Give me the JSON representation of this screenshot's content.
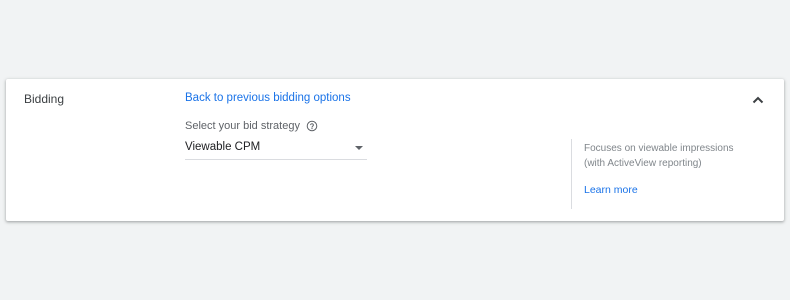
{
  "bidding": {
    "title": "Bidding",
    "back_link": "Back to previous bidding options",
    "strategy_label": "Select your bid strategy",
    "strategy_value": "Viewable CPM",
    "description": "Focuses on viewable impressions (with ActiveView reporting)",
    "learn_more": "Learn more"
  },
  "icons": {
    "help": "help-circle-icon",
    "dropdown": "dropdown-arrow-icon",
    "collapse": "chevron-up-icon"
  },
  "colors": {
    "background": "#f1f3f4",
    "link": "#1a73e8",
    "text": "#3c4043",
    "muted": "#80868b"
  }
}
